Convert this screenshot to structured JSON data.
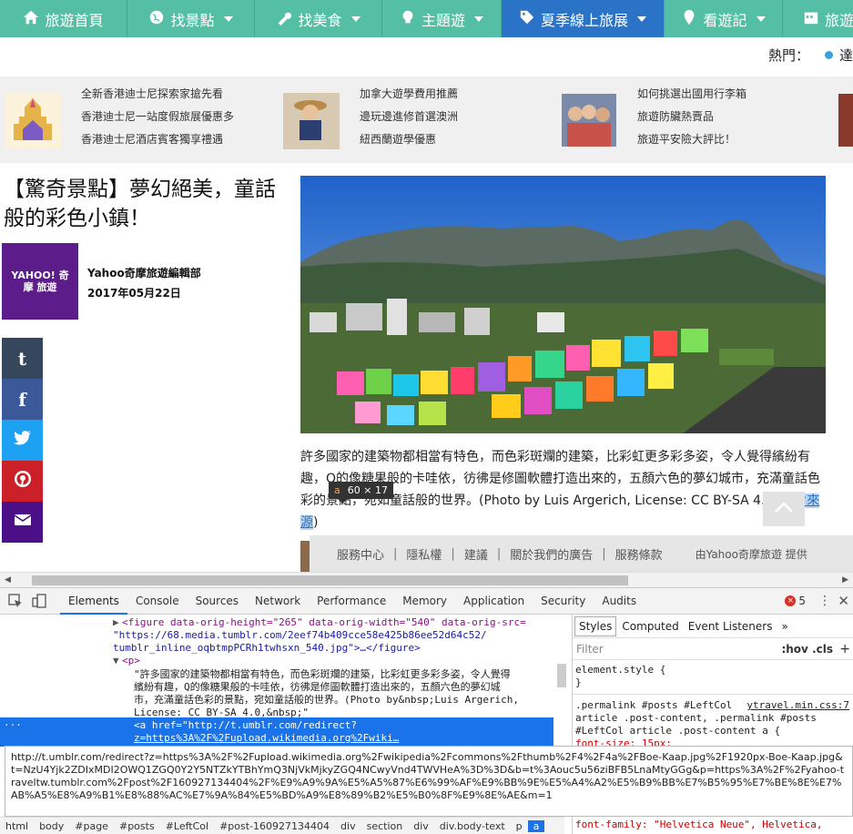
{
  "nav": {
    "items": [
      {
        "label": "旅遊首頁",
        "icon": "home-icon"
      },
      {
        "label": "找景點",
        "icon": "globe-icon"
      },
      {
        "label": "找美食",
        "icon": "wrench-icon"
      },
      {
        "label": "主題遊",
        "icon": "lightbulb-icon"
      },
      {
        "label": "夏季線上旅展",
        "icon": "tag-icon"
      },
      {
        "label": "看遊記",
        "icon": "map-marker-icon"
      },
      {
        "label": "旅遊",
        "icon": "calendar-icon"
      }
    ]
  },
  "hot": {
    "label": "熱門：",
    "item": "達"
  },
  "promos": [
    {
      "links": [
        "全新香港迪士尼探索家搶先看",
        "香港迪士尼一站度假旅展優惠多",
        "香港迪士尼酒店賓客獨享禮遇"
      ]
    },
    {
      "links": [
        "加拿大遊學費用推薦",
        "邊玩邊進修首選澳洲",
        "紐西蘭遊學優惠"
      ]
    },
    {
      "links": [
        "如何挑選出國用行李箱",
        "旅遊防臟熱賣品",
        "旅遊平安險大評比！"
      ]
    }
  ],
  "article": {
    "title": "【驚奇景點】夢幻絕美，童話般的彩色小鎮！",
    "author_logo": "YAHOO! 奇摩 旅遊",
    "author": "Yahoo奇摩旅遊編輯部",
    "date": "2017年05月22日",
    "caption_text": "許多國家的建築物都相當有特色，而色彩斑斕的建築，比彩虹更多彩多姿，令人覺得繽紛有趣，Q的像糖果般的卡哇依，彷彿是修圖軟體打造出來的，五顏六色的夢幻城市，充滿童話色彩的景點，宛如童話般的世界。(Photo by Luis Argerich, License: CC BY-SA 4.0, ",
    "caption_link": "圖片來源",
    "caption_end": ")"
  },
  "share": [
    {
      "icon": "tumblr-icon",
      "glyph": "t",
      "color": "#36465d"
    },
    {
      "icon": "facebook-icon",
      "glyph": "f",
      "color": "#3b5998"
    },
    {
      "icon": "twitter-icon",
      "glyph": "",
      "color": "#1da1f2"
    },
    {
      "icon": "pinterest-icon",
      "glyph": "",
      "color": "#cb2027"
    },
    {
      "icon": "email-icon",
      "glyph": "",
      "color": "#4b0f87"
    }
  ],
  "tooltip": {
    "tag": "a",
    "size": "60 × 17"
  },
  "footer": {
    "links": [
      "服務中心",
      "隱私權",
      "建議",
      "關於我們的廣告",
      "服務條款"
    ],
    "provided": "由Yahoo奇摩旅遊 提供"
  },
  "devtools": {
    "tabs": [
      "Elements",
      "Console",
      "Sources",
      "Network",
      "Performance",
      "Memory",
      "Application",
      "Security",
      "Audits"
    ],
    "active_tab": "Elements",
    "error_count": "5",
    "lines": [
      "<figure data-orig-height=\"265\" data-orig-width=\"540\" data-orig-src=",
      "\"https://68.media.tumblr.com/2eef74b409cce58e425b86ee52d64c52/",
      "tumblr_inline_oqbtmpPCRh1twhsxn_540.jpg\">…</figure>",
      "<p>",
      "\"許多國家的建築物都相當有特色，而色彩斑斕的建築，比彩虹更多彩多姿，令人覺得",
      "繽紛有趣，Q的像糖果般的卡哇依，彷彿是修圖軟體打造出來的，五顏六色的夢幻城",
      "市，充滿童話色彩的景點，宛如童話般的世界。(Photo by&nbsp;Luis Argerich,",
      "License: CC BY-SA 4.0,&nbsp;\"",
      "<a href=\"http://t.umblr.com/redirect?",
      "z=https%3A%2F%2Fupload.wikimedia.org%2Fwiki…"
    ],
    "styles_tabs": [
      "Styles",
      "Computed",
      "Event Listeners"
    ],
    "filter_placeholder": "Filter",
    "hov": ":hov",
    "cls": ".cls",
    "style_lines": [
      "element.style {",
      "}",
      ".permalink #posts #LeftCol",
      "article .post-content, .permalink #posts",
      "#LeftCol article .post-content a {",
      "  font-size: 15px;"
    ],
    "style_source": "ytravel.min.css:7",
    "font_family_line": "  font-family: \"Helvetica Neue\", Helvetica,",
    "url_popup": "http://t.umblr.com/redirect?z=https%3A%2F%2Fupload.wikimedia.org%2Fwikipedia%2Fcommons%2Fthumb%2F4%2F4a%2FBoe-Kaap.jpg%2F1920px-Boe-Kaap.jpg&t=NzU4Yjk2ZDIxMDI2OWQ1ZGQ0Y2Y5NTZkYTBhYmQ3NjVkMjkyZGQ4NCwyVnd4TWVHeA%3D%3D&b=t%3Aouc5u56ziBFB5LnaMtyGGg&p=https%3A%2F%2Fyahoo-traveltw.tumblr.com%2Fpost%2F160927134404%2F%E9%A9%9A%E5%A5%87%E6%99%AF%E9%BB%9E%E5%A4%A2%E5%B9%BB%E7%B5%95%E7%BE%8E%E7%AB%A5%E8%A9%B1%E8%88%AC%E7%9A%84%E5%BD%A9%E8%89%B2%E5%B0%8F%E9%8E%AE&m=1",
    "breadcrumbs": [
      "html",
      "body",
      "#page",
      "#posts",
      "#LeftCol",
      "#post-160927134404",
      "div",
      "section",
      "div",
      "div.body-text",
      "p",
      "a"
    ]
  }
}
